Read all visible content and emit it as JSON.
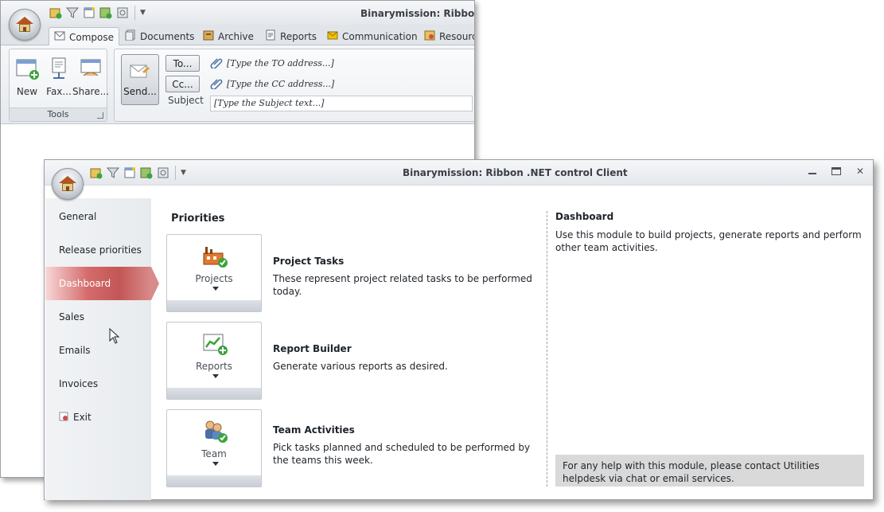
{
  "back_window": {
    "title": "Binarymission: Ribbon .N",
    "tabs": [
      {
        "label": "Compose",
        "icon": "compose-icon"
      },
      {
        "label": "Documents",
        "icon": "documents-icon"
      },
      {
        "label": "Archive",
        "icon": "archive-icon"
      },
      {
        "label": "Reports",
        "icon": "reports-icon"
      },
      {
        "label": "Communication",
        "icon": "communication-icon"
      },
      {
        "label": "Resourc",
        "icon": "resources-icon"
      }
    ],
    "tools_group": {
      "label": "Tools",
      "buttons": [
        {
          "label": "New",
          "icon": "new-icon"
        },
        {
          "label": "Fax...",
          "icon": "fax-icon"
        },
        {
          "label": "Share...",
          "icon": "share-icon"
        }
      ]
    },
    "compose_group": {
      "send_label": "Send...",
      "to_label": "To...",
      "cc_label": "Cc...",
      "subject_label": "Subject",
      "to_value": "[Type the TO address...]",
      "cc_value": "[Type the CC address...]",
      "subject_value": "[Type the Subject text...]"
    }
  },
  "front_window": {
    "title": "Binarymission: Ribbon .NET control Client",
    "nav": {
      "items": [
        {
          "label": "General",
          "active": false
        },
        {
          "label": "Release priorities",
          "active": false
        },
        {
          "label": "Dashboard",
          "active": true
        },
        {
          "label": "Sales",
          "active": false
        },
        {
          "label": "Emails",
          "active": false
        },
        {
          "label": "Invoices",
          "active": false
        },
        {
          "label": "Exit",
          "active": false,
          "icon": "exit-icon"
        }
      ]
    },
    "main": {
      "section_title": "Priorities",
      "modules": [
        {
          "card_label": "Projects",
          "icon": "projects-factory-icon",
          "title": "Project Tasks",
          "description": "These represent project related tasks to be performed today."
        },
        {
          "card_label": "Reports",
          "icon": "reports-chart-icon",
          "title": "Report Builder",
          "description": "Generate various reports as desired."
        },
        {
          "card_label": "Team",
          "icon": "team-icon",
          "title": "Team Activities",
          "description": "Pick tasks planned and scheduled to be performed by the teams this week."
        }
      ]
    },
    "info": {
      "title": "Dashboard",
      "description": "Use this module to build projects, generate reports and perform other team activities.",
      "help": "For any help with this module, please contact Utilities helpdesk via chat or email services."
    },
    "colors": {
      "active_nav": "#c35656",
      "help_box": "#d9d9d9"
    }
  }
}
